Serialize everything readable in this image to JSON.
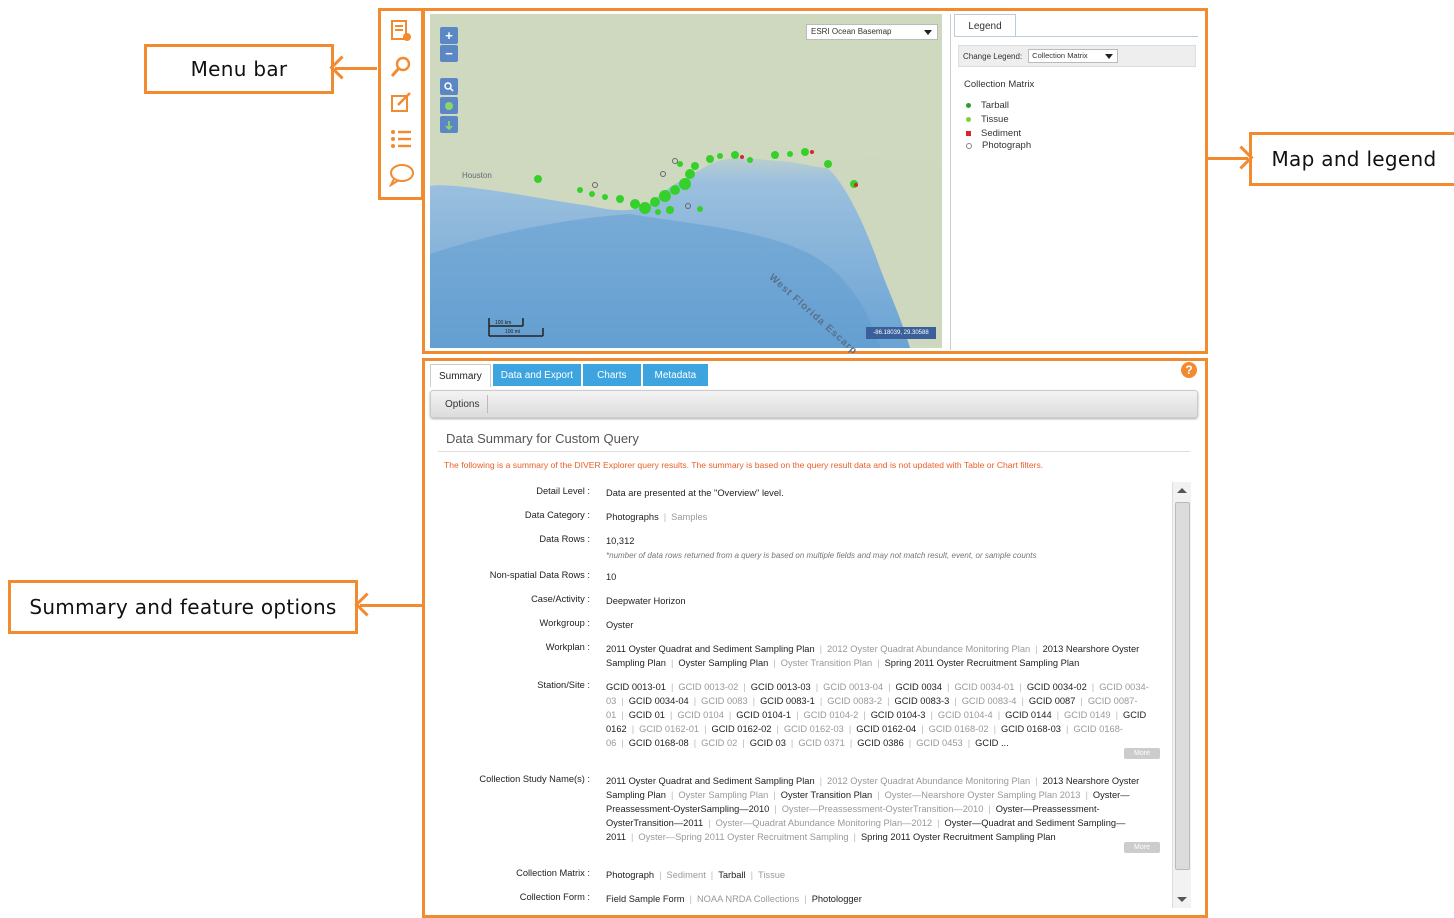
{
  "callouts": {
    "menu_bar": "Menu bar",
    "map_legend": "Map and legend",
    "summary_options": "Summary  and feature options"
  },
  "map": {
    "basemap": "ESRI Ocean Basemap",
    "zoom_in": "+",
    "zoom_out": "−",
    "label_houston": "Houston",
    "label_escarpment": "West Florida Escarp",
    "scale_km": "100 km",
    "scale_mi": "100 mi",
    "coords": "-86.18039, 29.30588"
  },
  "legend": {
    "tab": "Legend",
    "change_label": "Change Legend:",
    "selected": "Collection Matrix",
    "title": "Collection Matrix",
    "items": [
      {
        "label": "Tarball",
        "color": "#2ca02c"
      },
      {
        "label": "Tissue",
        "color": "#7bd13f"
      },
      {
        "label": "Sediment",
        "color": "#d62728"
      },
      {
        "label": "Photograph",
        "color": "#888888"
      }
    ]
  },
  "summary": {
    "tabs": [
      "Summary",
      "Data and Export",
      "Charts",
      "Metadata"
    ],
    "help": "?",
    "options": "Options",
    "title": "Data Summary for Custom Query",
    "note": "The following is a summary of the DIVER Explorer query results. The summary is based on the query result data and is not updated with Table or Chart filters.",
    "more": "More",
    "rows": {
      "detail_level": {
        "label": "Detail Level :",
        "value": "Data are presented at the \"Overview\" level."
      },
      "data_category": {
        "label": "Data Category :",
        "a": "Photographs",
        "b": "Samples"
      },
      "data_rows": {
        "label": "Data Rows :",
        "value": "10,312",
        "note": "*number of data rows returned from a query is based on multiple fields and may not match result, event, or sample counts"
      },
      "nonspatial": {
        "label": "Non-spatial Data Rows :",
        "value": "10"
      },
      "case": {
        "label": "Case/Activity :",
        "value": "Deepwater Horizon"
      },
      "workgroup": {
        "label": "Workgroup :",
        "value": "Oyster"
      },
      "workplan": {
        "label": "Workplan :",
        "items": [
          "2011 Oyster Quadrat and Sediment Sampling Plan",
          "2012 Oyster Quadrat Abundance Monitoring Plan",
          "2013 Nearshore Oyster Sampling Plan",
          "Oyster Sampling Plan",
          "Oyster Transition Plan",
          "Spring 2011 Oyster Recruitment Sampling Plan"
        ]
      },
      "station": {
        "label": "Station/Site :",
        "items": [
          "GCID 0013-01",
          "GCID 0013-02",
          "GCID 0013-03",
          "GCID 0013-04",
          "GCID 0034",
          "GCID 0034-01",
          "GCID 0034-02",
          "GCID 0034-03",
          "GCID 0034-04",
          "GCID 0083",
          "GCID 0083-1",
          "GCID 0083-2",
          "GCID 0083-3",
          "GCID 0083-4",
          "GCID 0087",
          "GCID 0087-01",
          "GCID 01",
          "GCID 0104",
          "GCID 0104-1",
          "GCID 0104-2",
          "GCID 0104-3",
          "GCID 0104-4",
          "GCID 0144",
          "GCID 0149",
          "GCID 0162",
          "GCID 0162-01",
          "GCID 0162-02",
          "GCID 0162-03",
          "GCID 0162-04",
          "GCID 0168-02",
          "GCID 0168-03",
          "GCID 0168-06",
          "GCID 0168-08",
          "GCID 02",
          "GCID 03",
          "GCID 0371",
          "GCID 0386",
          "GCID 0453",
          "GCID ..."
        ]
      },
      "study": {
        "label": "Collection Study Name(s) :",
        "items": [
          "2011 Oyster Quadrat and Sediment Sampling Plan",
          "2012 Oyster Quadrat Abundance Monitoring Plan",
          "2013 Nearshore Oyster Sampling Plan",
          "Oyster Sampling Plan",
          "Oyster Transition Plan",
          "Oyster—Nearshore Oyster Sampling Plan 2013",
          "Oyster—Preassessment-OysterSampling—2010",
          "Oyster—Preassessment-OysterTransition—2010",
          "Oyster—Preassessment-OysterTransition—2011",
          "Oyster—Quadrat Abundance Monitoring Plan—2012",
          "Oyster—Quadrat and Sediment Sampling—2011",
          "Oyster—Spring 2011 Oyster Recruitment Sampling",
          "Spring 2011 Oyster Recruitment Sampling Plan"
        ]
      },
      "matrix": {
        "label": "Collection Matrix :",
        "items": [
          "Photograph",
          "Sediment",
          "Tarball",
          "Tissue"
        ]
      },
      "form": {
        "label": "Collection Form :",
        "items": [
          "Field Sample Form",
          "NOAA NRDA Collections",
          "Photologger"
        ]
      }
    }
  }
}
